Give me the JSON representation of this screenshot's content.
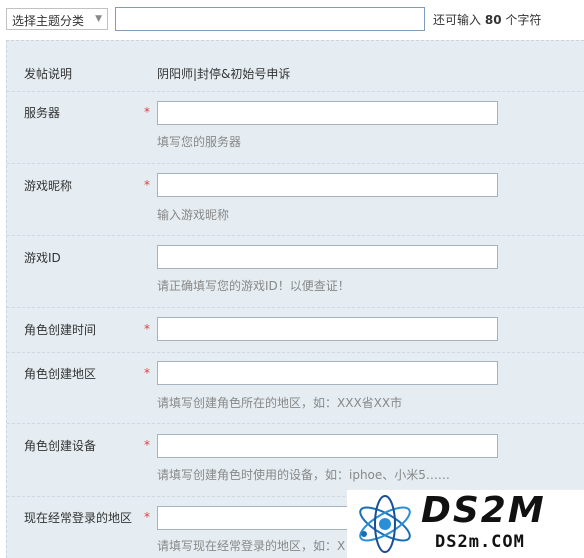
{
  "topbar": {
    "category_select": "选择主题分类",
    "title_value": "",
    "remain_prefix": "还可输入",
    "remain_count": "80",
    "remain_suffix": "个字符"
  },
  "form": {
    "description_label": "发帖说明",
    "description_value": "阴阳师|封停&初始号申诉",
    "required_mark": "*",
    "fields": [
      {
        "label": "服务器",
        "required": true,
        "value": "",
        "hint": "填写您的服务器"
      },
      {
        "label": "游戏昵称",
        "required": true,
        "value": "",
        "hint": "输入游戏昵称"
      },
      {
        "label": "游戏ID",
        "required": false,
        "value": "",
        "hint": "请正确填写您的游戏ID！以便查证！"
      },
      {
        "label": "角色创建时间",
        "required": true,
        "value": "",
        "hint": ""
      },
      {
        "label": "角色创建地区",
        "required": true,
        "value": "",
        "hint": "请填写创建角色所在的地区，如：XXX省XX市"
      },
      {
        "label": "角色创建设备",
        "required": true,
        "value": "",
        "hint": "请填写创建角色时使用的设备，如：iphoe、小米5……"
      },
      {
        "label": "现在经常登录的地区",
        "required": true,
        "value": "",
        "hint": "请填写现在经常登录的地区，如：X"
      }
    ]
  },
  "watermark": {
    "big": "DS2M",
    "small": "DS2m.COM"
  },
  "icons": {
    "select_chevron": "chevron-down-icon",
    "watermark_logo": "atom-logo-icon"
  },
  "colors": {
    "panel_bg": "#e5edf2",
    "required": "#e03e3e",
    "hint": "#888888"
  }
}
